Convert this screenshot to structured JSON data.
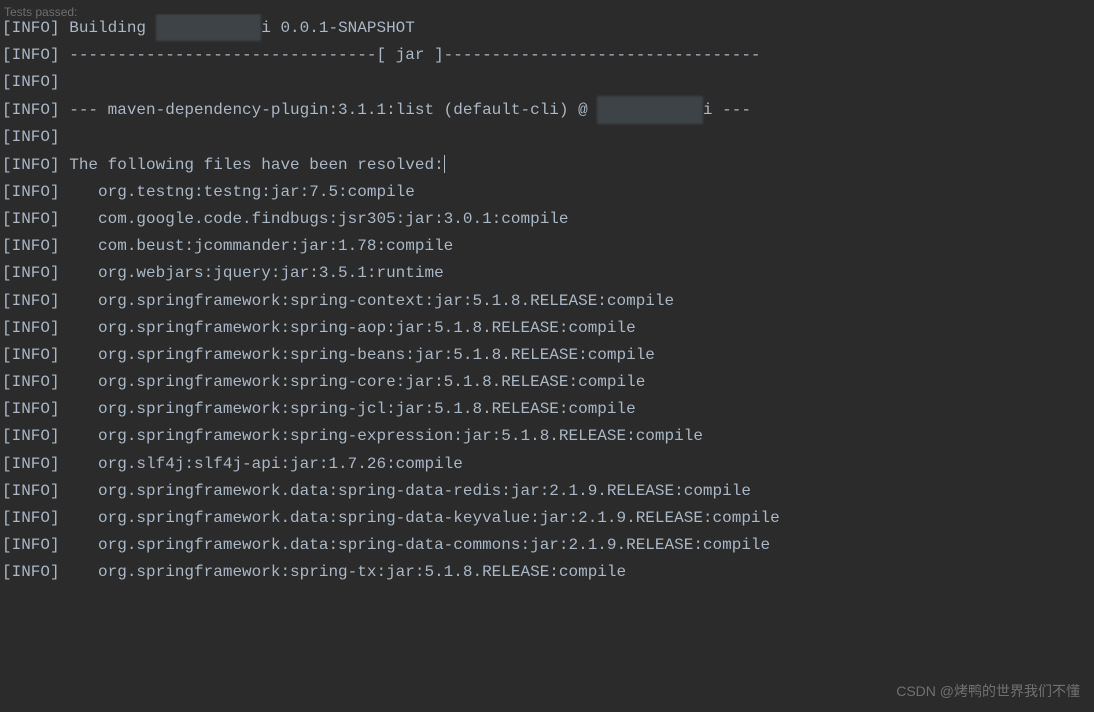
{
  "status_bar": {
    "text": "Tests passed:"
  },
  "console": {
    "prefix": "[INFO]",
    "lines": [
      {
        "type": "build",
        "text_before": "[INFO] Building ",
        "redacted": "xxxxxxxxxxx",
        "text_after": "i 0.0.1-SNAPSHOT"
      },
      {
        "type": "plain",
        "text": "[INFO] --------------------------------[ jar ]---------------------------------"
      },
      {
        "type": "plain",
        "text": "[INFO]"
      },
      {
        "type": "plugin",
        "text_before": "[INFO] --- maven-dependency-plugin:3.1.1:list (default-cli) @ ",
        "redacted": "xxxxxxxxxxx",
        "text_after": "i ---"
      },
      {
        "type": "plain",
        "text": "[INFO]"
      },
      {
        "type": "plain_cursor",
        "text": "[INFO] The following files have been resolved:"
      },
      {
        "type": "plain",
        "text": "[INFO]    org.testng:testng:jar:7.5:compile"
      },
      {
        "type": "plain",
        "text": "[INFO]    com.google.code.findbugs:jsr305:jar:3.0.1:compile"
      },
      {
        "type": "plain",
        "text": "[INFO]    com.beust:jcommander:jar:1.78:compile"
      },
      {
        "type": "plain",
        "text": "[INFO]    org.webjars:jquery:jar:3.5.1:runtime"
      },
      {
        "type": "plain",
        "text": "[INFO]    org.springframework:spring-context:jar:5.1.8.RELEASE:compile"
      },
      {
        "type": "plain",
        "text": "[INFO]    org.springframework:spring-aop:jar:5.1.8.RELEASE:compile"
      },
      {
        "type": "plain",
        "text": "[INFO]    org.springframework:spring-beans:jar:5.1.8.RELEASE:compile"
      },
      {
        "type": "plain",
        "text": "[INFO]    org.springframework:spring-core:jar:5.1.8.RELEASE:compile"
      },
      {
        "type": "plain",
        "text": "[INFO]    org.springframework:spring-jcl:jar:5.1.8.RELEASE:compile"
      },
      {
        "type": "plain",
        "text": "[INFO]    org.springframework:spring-expression:jar:5.1.8.RELEASE:compile"
      },
      {
        "type": "plain",
        "text": "[INFO]    org.slf4j:slf4j-api:jar:1.7.26:compile"
      },
      {
        "type": "plain",
        "text": "[INFO]    org.springframework.data:spring-data-redis:jar:2.1.9.RELEASE:compile"
      },
      {
        "type": "plain",
        "text": "[INFO]    org.springframework.data:spring-data-keyvalue:jar:2.1.9.RELEASE:compile"
      },
      {
        "type": "plain",
        "text": "[INFO]    org.springframework.data:spring-data-commons:jar:2.1.9.RELEASE:compile"
      },
      {
        "type": "plain",
        "text": "[INFO]    org.springframework:spring-tx:jar:5.1.8.RELEASE:compile"
      }
    ]
  },
  "watermark": "CSDN @烤鸭的世界我们不懂"
}
